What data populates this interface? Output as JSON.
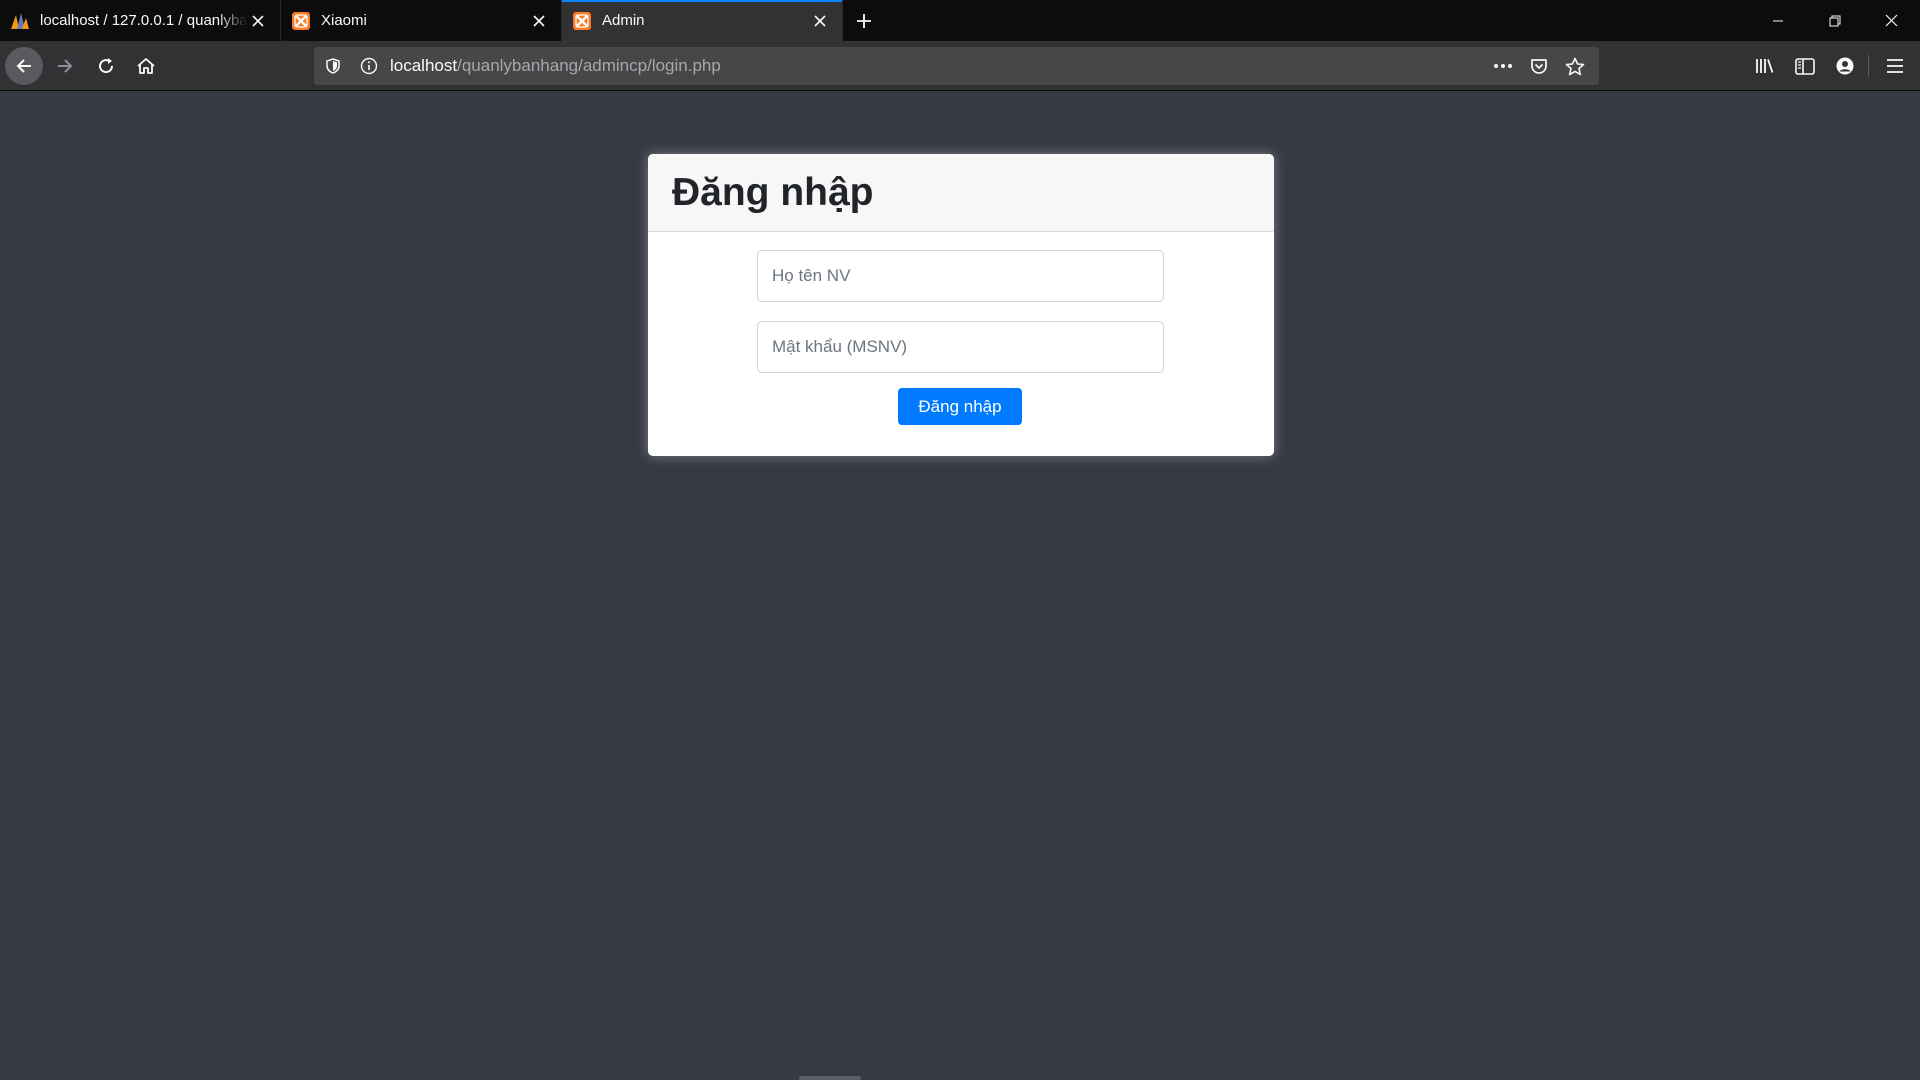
{
  "browser": {
    "tabs": [
      {
        "title": "localhost / 127.0.0.1 / quanlybanhang",
        "icon": "phpmyadmin-icon",
        "active": false
      },
      {
        "title": "Xiaomi",
        "icon": "xampp-icon",
        "active": false
      },
      {
        "title": "Admin",
        "icon": "xampp-icon",
        "active": true
      }
    ],
    "url": {
      "host": "localhost",
      "path": "/quanlybanhang/admincp/login.php"
    }
  },
  "login": {
    "title": "Đăng nhập",
    "username_placeholder": "Họ tên NV",
    "password_placeholder": "Mật khẩu (MSNV)",
    "submit_label": "Đăng nhập"
  },
  "colors": {
    "page_background": "#363a43",
    "primary_button": "#007bff",
    "active_tab_accent": "#0a84ff",
    "xampp_orange": "#fb7a24"
  }
}
